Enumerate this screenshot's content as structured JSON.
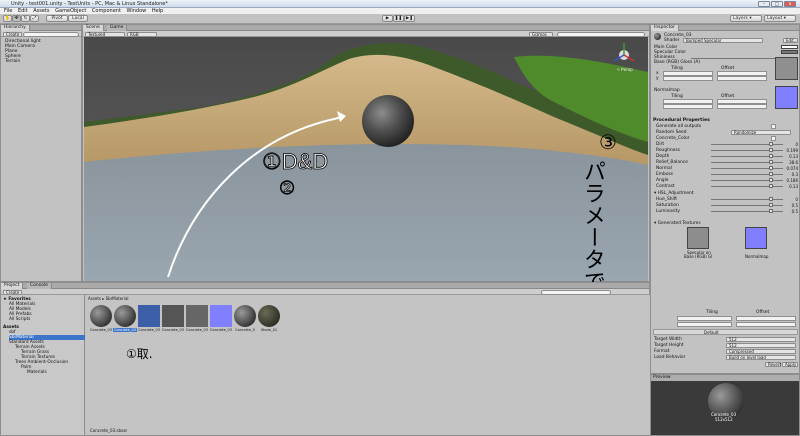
{
  "window": {
    "title": "Unity - test001.unity - TestUnits - PC, Mac & Linux Standalone*",
    "controls": [
      "–",
      "□",
      "✕"
    ]
  },
  "menubar": [
    "File",
    "Edit",
    "Assets",
    "GameObject",
    "Component",
    "Window",
    "Help"
  ],
  "toolbar": {
    "pivot": "Pivot",
    "local": "Local",
    "layers": "Layers",
    "layout": "Layout"
  },
  "hierarchy": {
    "tab": "Hierarchy",
    "create": "Create",
    "items": [
      "Directional light",
      "Main Camera",
      "Plane",
      "Sphere",
      "Terrain"
    ]
  },
  "scene": {
    "tab_scene": "Scene",
    "tab_game": "Game",
    "shading": "Textured",
    "render": "RGB",
    "gizmos": "Gizmos",
    "persp": "< Persp"
  },
  "annotations": {
    "step1": "①D&D",
    "step1b": "②",
    "step0": "①取.",
    "step3": "③",
    "step3_text": "パラメータで調整"
  },
  "project": {
    "tab_project": "Project",
    "tab_console": "Console",
    "create": "Create",
    "favorites_label": "Favorites",
    "favorites": [
      "All Materials",
      "All Models",
      "All Prefabs",
      "All Scripts"
    ],
    "assets_root": "Assets",
    "folders": [
      "sbf",
      "SbrMaterial",
      "Standard Assets",
      "Terrain Assets",
      "Terrain Grass",
      "Terrain Textures",
      "Trees Ambient-Occlusion",
      "Palm",
      "Materials"
    ],
    "breadcrumb": "Assets ▸ SbrMaterial",
    "assets": [
      "Concrete_03",
      "Concrete_03",
      "Concrete_03",
      "Concrete_03",
      "Concrete_03",
      "Concrete_03",
      "Concrete_0",
      "Stone_01"
    ],
    "status": "Concrete_03.sbsar"
  },
  "inspector": {
    "tab": "Inspector",
    "object_name": "Concrete_03",
    "shader_label": "Shader",
    "shader_value": "Bumped Specular",
    "edit": "Edit...",
    "main_color": "Main Color",
    "specular_color": "Specular Color",
    "shininess": "Shininess",
    "base_label": "Base (RGB) Gloss (A)",
    "tiling": "Tiling",
    "offset": "Offset",
    "x": "x",
    "y": "y",
    "tile_values": [
      "1",
      "1",
      "0",
      "0"
    ],
    "normalmap": "Normalmap",
    "procedural_header": "Procedural Properties",
    "procedural": [
      {
        "label": "Generate all outputs",
        "value": ""
      },
      {
        "label": "Random Seed",
        "value": "Randomize"
      },
      {
        "label": "Concrete_Color",
        "value": ""
      },
      {
        "label": "Dirt",
        "value": "0"
      },
      {
        "label": "Roughness",
        "value": "0.199"
      },
      {
        "label": "Depth",
        "value": "0.13"
      },
      {
        "label": "Relief_Balance",
        "value": "38.6"
      },
      {
        "label": "Normal",
        "value": "0.074"
      },
      {
        "label": "Emboss",
        "value": "0.3"
      },
      {
        "label": "Angle",
        "value": "0.186"
      },
      {
        "label": "Contrast",
        "value": "0.13"
      }
    ],
    "hsl_header": "HSL_Adjustment",
    "hsl": [
      {
        "label": "Hue_Shift",
        "value": "0"
      },
      {
        "label": "Saturation",
        "value": "0.5"
      },
      {
        "label": "Luminosity",
        "value": "0.5"
      }
    ],
    "generated_header": "Generated Textures",
    "generated": [
      "Base (RGB) Gl",
      "Normalmap"
    ],
    "generated_caption": "Specular on",
    "platform": "Default",
    "target_width_label": "Target Width",
    "target_width": "512",
    "target_height_label": "Target Height",
    "target_height": "512",
    "format_label": "Format",
    "format": "Compressed",
    "load_behavior_label": "Load Behavior",
    "load_behavior": "Build on level load",
    "revert": "Revert",
    "apply": "Apply"
  },
  "preview": {
    "header": "Preview",
    "caption": "Concrete_03",
    "size": "512x512"
  },
  "colors": {
    "sky_top": "#555555",
    "sand": "#c7ad7b",
    "ground": "#8e9aa6",
    "grass": "#4f8a2b",
    "normal_blue": "#7f7fff",
    "select_blue": "#3b74c9"
  }
}
